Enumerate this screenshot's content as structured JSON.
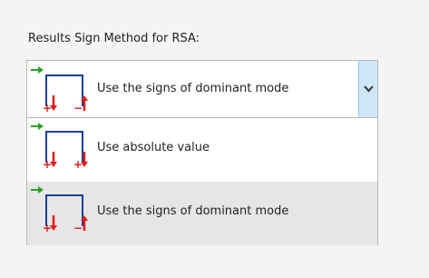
{
  "field_label": "Results Sign Method for RSA:",
  "combo": {
    "selected_label": "Use the signs of dominant mode",
    "selected_icon": "dominant-mode-sign-icon"
  },
  "options": [
    {
      "label": "Use absolute value",
      "icon": "absolute-value-sign-icon",
      "selected": false
    },
    {
      "label": "Use the signs of dominant mode",
      "icon": "dominant-mode-sign-icon",
      "selected": true
    }
  ],
  "colors": {
    "frame_blue": "#1a3f9a",
    "arrow_green": "#2aa02a",
    "arrow_red": "#e21b1b",
    "dropdown_button": "#cfe6f8",
    "selected_row": "#e6e6e6"
  },
  "icon_glyphs": {
    "plus": "+",
    "minus": "−"
  }
}
